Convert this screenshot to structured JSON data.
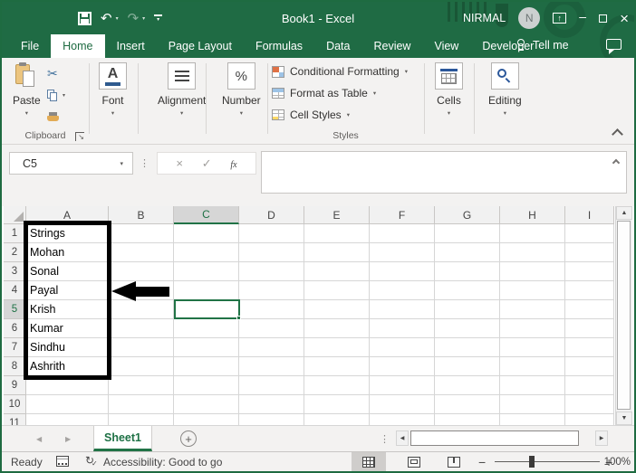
{
  "window": {
    "title": "Book1 - Excel"
  },
  "user": {
    "name": "NIRMAL",
    "initial": "N"
  },
  "menu_tabs": [
    {
      "label": "File",
      "active": false
    },
    {
      "label": "Home",
      "active": true
    },
    {
      "label": "Insert",
      "active": false
    },
    {
      "label": "Page Layout",
      "active": false
    },
    {
      "label": "Formulas",
      "active": false
    },
    {
      "label": "Data",
      "active": false
    },
    {
      "label": "Review",
      "active": false
    },
    {
      "label": "View",
      "active": false
    },
    {
      "label": "Developer",
      "active": false
    }
  ],
  "tell_me": "Tell me",
  "ribbon": {
    "paste_label": "Paste",
    "clipboard_label": "Clipboard",
    "font_label": "Font",
    "alignment_label": "Alignment",
    "number_label": "Number",
    "number_icon": "%",
    "font_icon_letter": "A",
    "styles_items": [
      "Conditional Formatting",
      "Format as Table",
      "Cell Styles"
    ],
    "styles_label": "Styles",
    "cells_label": "Cells",
    "editing_label": "Editing"
  },
  "formula_bar": {
    "name_box_value": "C5",
    "fx_label": "fx",
    "formula_value": ""
  },
  "grid": {
    "column_headers": [
      "A",
      "B",
      "C",
      "D",
      "E",
      "F",
      "G",
      "H",
      "I"
    ],
    "row_headers": [
      "1",
      "2",
      "3",
      "4",
      "5",
      "6",
      "7",
      "8",
      "9",
      "10",
      "11"
    ],
    "selected_column": "C",
    "selected_row": "5",
    "selected_cell": "C5",
    "column_a_values": [
      "Strings",
      "Mohan",
      "Sonal",
      "Payal",
      "Krish",
      "Kumar",
      "Sindhu",
      "Ashrith"
    ]
  },
  "sheet_bar": {
    "active_tab": "Sheet1",
    "new_sheet_icon": "+"
  },
  "status_bar": {
    "mode": "Ready",
    "accessibility": "Accessibility: Good to go",
    "zoom_label": "100%",
    "zoom_percent": 33
  },
  "glyphs": {
    "undo": "↶",
    "redo": "↷",
    "caret_down": "▾",
    "check": "✓",
    "cancel": "×",
    "scissors": "✂",
    "minimize": "–",
    "close": "×",
    "scroll_up": "▲",
    "scroll_down": "▼",
    "scroll_left": "◀",
    "scroll_right": "▶",
    "nav_left": "◀",
    "nav_right": "▶",
    "dots_vertical": "⋮",
    "accessibility_arrows": "↻",
    "ribbon_display_arrow": "↑",
    "zoom_minus": "−",
    "zoom_plus": "+",
    "dialog_launcher": "↘"
  },
  "colors": {
    "excel_green": "#217346",
    "title_bar_green": "#1f6b44",
    "selection_border": "#217346",
    "annotation_black": "#000000",
    "ribbon_bg": "#f3f2f1",
    "gridline": "#d6d6d6",
    "header_selected_bg": "#d6d6d6"
  }
}
